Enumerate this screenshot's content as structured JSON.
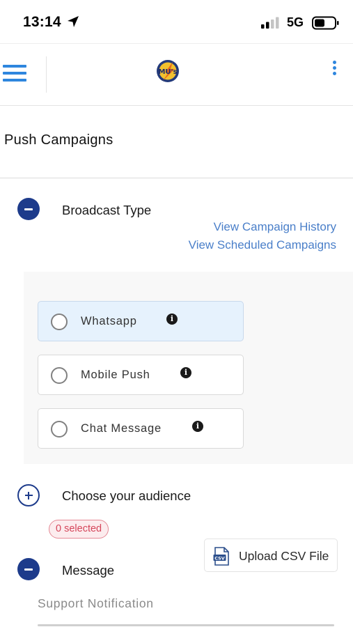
{
  "status_bar": {
    "time": "13:14",
    "network": "5G",
    "icons": [
      "location-arrow-icon",
      "signal-icon",
      "battery-icon"
    ]
  },
  "header": {
    "logo_text": "MU's",
    "icons": [
      "menu-icon",
      "kebab-menu-icon"
    ]
  },
  "page": {
    "title": "Push Campaigns"
  },
  "broadcast": {
    "label": "Broadcast Type",
    "links": {
      "history": "View Campaign History",
      "scheduled": "View Scheduled Campaigns"
    },
    "options": [
      {
        "label": "Whatsapp",
        "selected": true
      },
      {
        "label": "Mobile Push",
        "selected": false
      },
      {
        "label": "Chat Message",
        "selected": false
      }
    ]
  },
  "audience": {
    "label": "Choose your audience",
    "selected_badge": "0 selected",
    "upload_label": "Upload CSV File",
    "csv_icon_text": "CSV"
  },
  "message": {
    "label": "Message",
    "field_value": "Support Notification"
  },
  "colors": {
    "accent_blue": "#2e86de",
    "toggle_navy": "#1d3b8b",
    "link_blue": "#4a7fc9",
    "selected_bg": "#e6f2fd",
    "badge_red": "#d5455a"
  }
}
